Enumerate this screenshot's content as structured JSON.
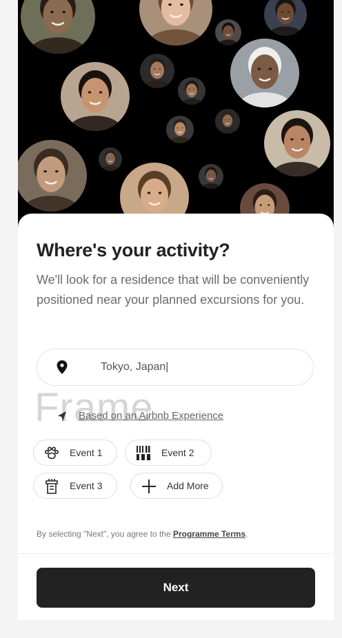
{
  "hero": {
    "faces": [
      {
        "skin": "#8a6a50",
        "hair": "#2a1d15",
        "bg": "#6e6f58"
      },
      {
        "skin": "#e4bba0",
        "hair": "#6a4a30",
        "bg": "#a8907a"
      },
      {
        "skin": "#6d4a34",
        "hair": "#1a1512",
        "bg": "#3a4050"
      },
      {
        "skin": "#c7946f",
        "hair": "#1a120e",
        "bg": "#b8a590"
      },
      {
        "skin": "#a47a5c",
        "hair": "#2a1f19",
        "bg": "#2b2b2b"
      },
      {
        "skin": "#74503a",
        "hair": "#151010",
        "bg": "#4e4a48"
      },
      {
        "skin": "#9b7356",
        "hair": "#201814",
        "bg": "#353535"
      },
      {
        "skin": "#b48866",
        "hair": "#2d2218",
        "bg": "#3a3a3a"
      },
      {
        "skin": "#7c5a44",
        "hair": "#efefef",
        "bg": "#9aa0a6"
      },
      {
        "skin": "#8d6a52",
        "hair": "#2a211b",
        "bg": "#2a2a2a"
      },
      {
        "skin": "#b98564",
        "hair": "#1c1410",
        "bg": "#c8bba8"
      },
      {
        "skin": "#c19b7c",
        "hair": "#3a2a20",
        "bg": "#7a6c5c"
      },
      {
        "skin": "#8a6a54",
        "hair": "#2a201a",
        "bg": "#2f2f2f"
      },
      {
        "skin": "#d8ab8a",
        "hair": "#5a3e28",
        "bg": "#c8a888"
      },
      {
        "skin": "#7b5a48",
        "hair": "#1d1612",
        "bg": "#383838"
      },
      {
        "skin": "#c69c78",
        "hair": "#2b1e16",
        "bg": "#6a4a3e"
      }
    ]
  },
  "title": "Where's your activity?",
  "description": "We'll look for a residence that will be conveniently positioned near your planned excursions for you.",
  "location_input": {
    "value": "Tokyo, Japan|",
    "icon": "location-pin-icon"
  },
  "watermark": "Frame",
  "based_on": {
    "label": "Based on an Airbnb Experience",
    "icon": "navigation-arrow-icon"
  },
  "events": [
    {
      "label": "Event 1",
      "icon": "paw-icon"
    },
    {
      "label": "Event 2",
      "icon": "pot-icon"
    },
    {
      "label": "Event 3",
      "icon": "grill-icon"
    },
    {
      "label": "Add More",
      "icon": "plus-icon"
    }
  ],
  "terms": {
    "prefix": "By selecting \"Next\", you agree to the ",
    "link": "Programme Terms",
    "suffix": "."
  },
  "next_button": "Next",
  "colors": {
    "primary_button": "#222222",
    "hero_background": "#000000",
    "page_background": "#f4f4f4"
  }
}
